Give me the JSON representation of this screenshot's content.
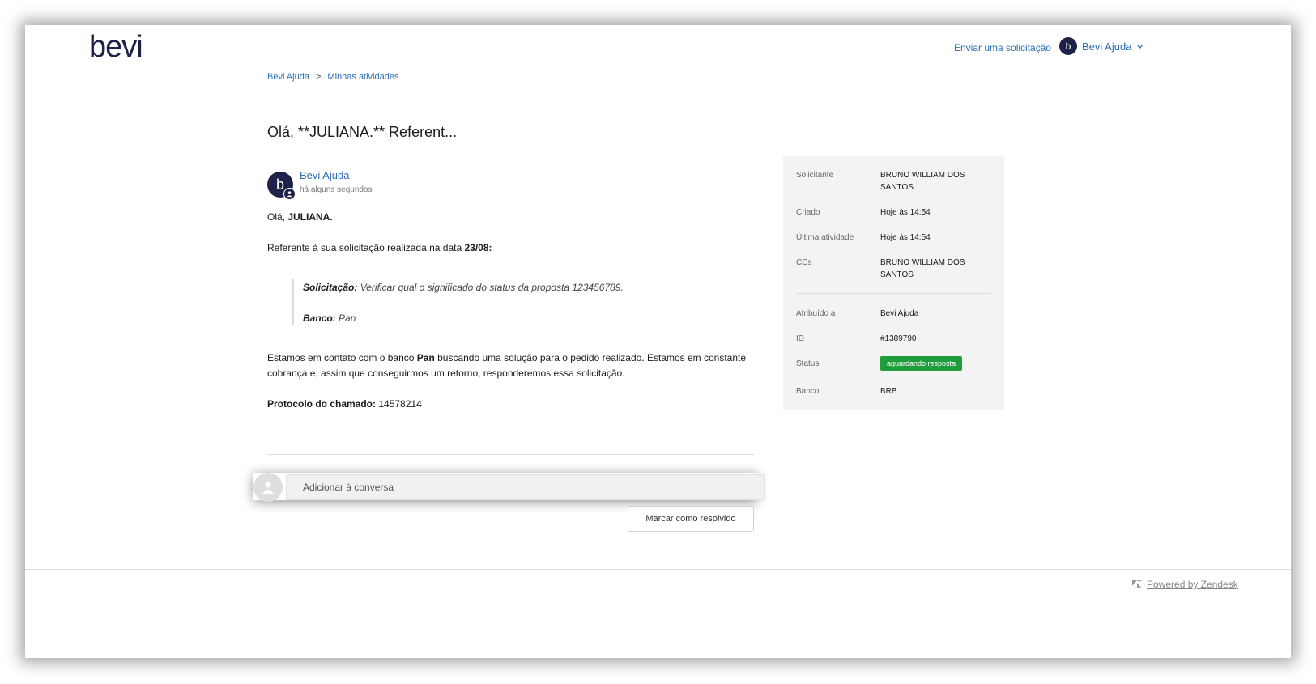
{
  "header": {
    "logo_text": "bevi",
    "submit_request_link": "Enviar uma solicitação",
    "user_menu": {
      "avatar_letter": "b",
      "label": "Bevi Ajuda",
      "chevron": "chevron-down-icon"
    }
  },
  "breadcrumb": {
    "items": [
      "Bevi Ajuda",
      "Minhas atividades"
    ],
    "separator": ">"
  },
  "request": {
    "title": "Olá, **JULIANA.** Referent...",
    "comment": {
      "avatar_letter": "b",
      "author": "Bevi Ajuda",
      "time": "há alguns segundos",
      "greeting_prefix": "Olá, ",
      "greeting_name": "JULIANA.",
      "ref_text": "Referente à sua solicitação realizada na data ",
      "ref_date": "23/08:",
      "quote_request_label": "Solicitação:",
      "quote_request_text": "Verificar qual o significado do status da proposta 123456789.",
      "quote_bank_label": "Banco:",
      "quote_bank_text": "Pan",
      "contact_prefix": "Estamos em contato com o banco ",
      "contact_bank": "Pan",
      "contact_suffix": " buscando uma solução para o pedido realizado.  Estamos em constante",
      "contact_line2": "cobrança e, assim que conseguirmos um retorno, responderemos essa solicitação.",
      "protocol_label": "Protocolo do chamado:",
      "protocol_value": " 14578214"
    }
  },
  "sidebar": {
    "requester_label": "Solicitante",
    "requester_value_1": "BRUNO WILLIAM DOS",
    "requester_value_2": "SANTOS",
    "created_label": "Criado",
    "created_value": "Hoje às 14:54",
    "last_activity_label": "Última atividade",
    "last_activity_value": "Hoje às 14:54",
    "ccs_label": "CCs",
    "ccs_value_1": "BRUNO WILLIAM DOS",
    "ccs_value_2": "SANTOS",
    "assigned_label": "Atribuído a",
    "assigned_value": "Bevi Ajuda",
    "id_label": "ID",
    "id_value": "#1389790",
    "status_label": "Status",
    "status_value": "aguardando resposta",
    "status_color": "#1f9c3b",
    "bank_label": "Banco",
    "bank_value": "BRB"
  },
  "reply": {
    "placeholder": "Adicionar à conversa",
    "resolve_button": "Marcar como resolvido"
  },
  "footer": {
    "powered_by": "Powered by Zendesk",
    "icon": "zendesk-icon"
  }
}
